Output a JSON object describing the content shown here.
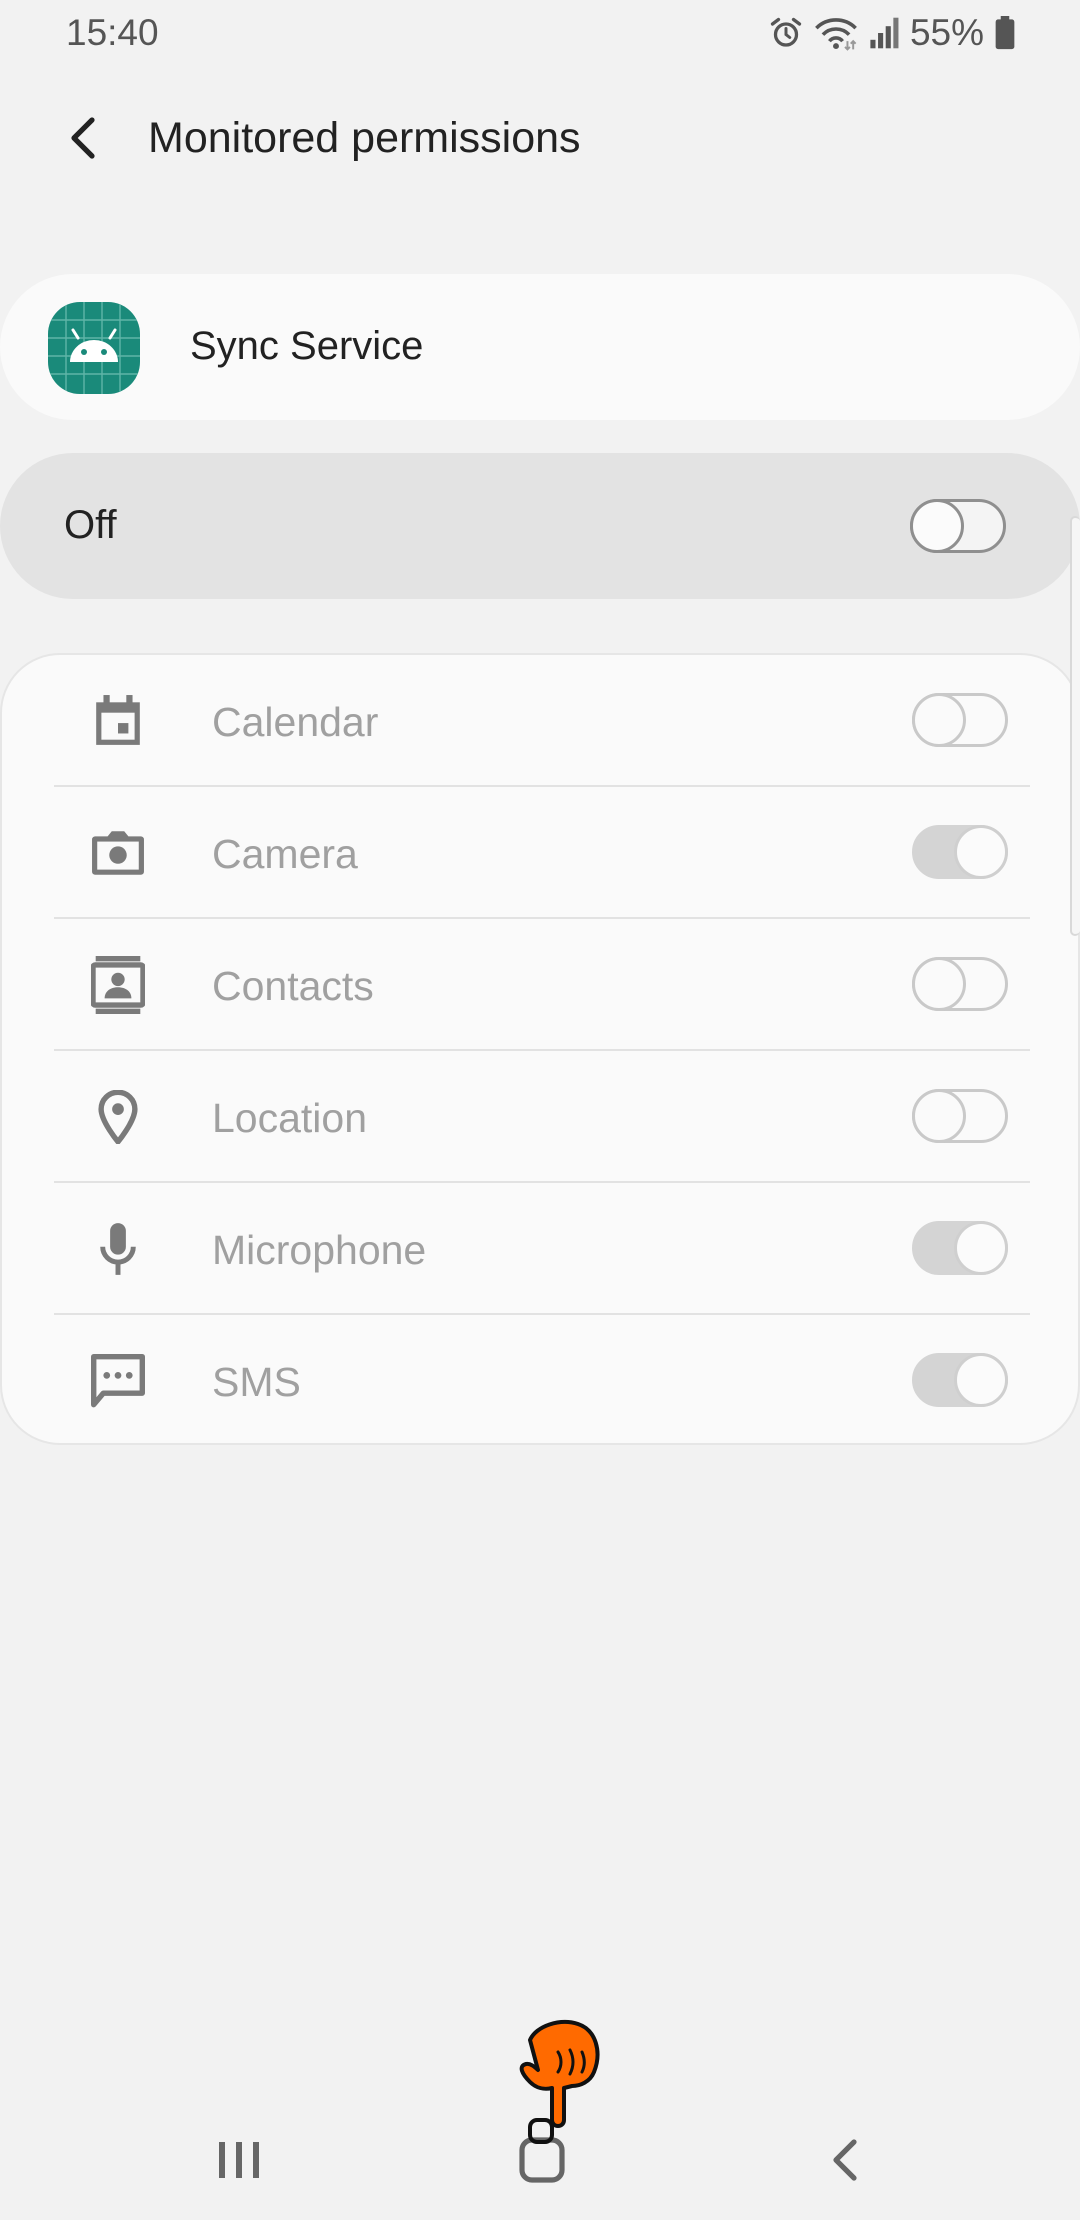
{
  "status_bar": {
    "time": "15:40",
    "battery": "55%",
    "icons": [
      "alarm-icon",
      "wifi-icon",
      "signal-icon",
      "battery-icon"
    ]
  },
  "header": {
    "title": "Monitored permissions",
    "back_icon": "chevron-left-icon"
  },
  "app": {
    "name": "Sync Service",
    "icon": "android-app-icon",
    "icon_color": "#1a8a7a"
  },
  "master_switch": {
    "label": "Off",
    "state": "off"
  },
  "permissions": [
    {
      "label": "Calendar",
      "icon": "calendar-icon",
      "state": "off"
    },
    {
      "label": "Camera",
      "icon": "camera-icon",
      "state": "on"
    },
    {
      "label": "Contacts",
      "icon": "contacts-icon",
      "state": "off"
    },
    {
      "label": "Location",
      "icon": "location-icon",
      "state": "off"
    },
    {
      "label": "Microphone",
      "icon": "microphone-icon",
      "state": "on"
    },
    {
      "label": "SMS",
      "icon": "sms-icon",
      "state": "on"
    }
  ],
  "nav_bar": {
    "recents_icon": "recents-icon",
    "home_icon": "home-icon",
    "back_icon": "back-icon"
  }
}
